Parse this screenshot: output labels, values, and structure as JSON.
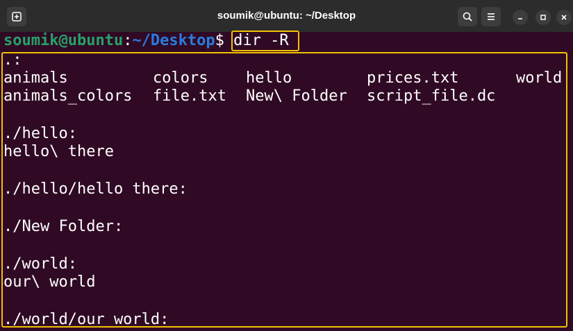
{
  "window": {
    "title": "soumik@ubuntu: ~/Desktop",
    "icons": [
      "new-tab-icon",
      "search-icon",
      "menu-icon",
      "minimize-icon",
      "maximize-icon",
      "close-icon"
    ]
  },
  "prompt": {
    "user": "soumik@ubuntu",
    "sep": ":",
    "path": "~/Desktop",
    "symbol": "$",
    "command": "dir -R"
  },
  "output": {
    "root_header": ".:",
    "row1": [
      "animals",
      "colors",
      "hello",
      "prices.txt",
      "world"
    ],
    "row2": [
      "animals_colors",
      "file.txt",
      "New\\ Folder",
      "script_file.dc"
    ],
    "hello_header": "./hello:",
    "hello_items": "hello\\ there",
    "hello_there_header": "./hello/hello there:",
    "new_folder_header": "./New Folder:",
    "world_header": "./world:",
    "world_items": "our\\ world",
    "our_world_header": "./world/our world:"
  },
  "colors": {
    "background": "#300a24",
    "user": "#26a269",
    "path": "#2a7bde",
    "highlight": "#f2c200"
  }
}
